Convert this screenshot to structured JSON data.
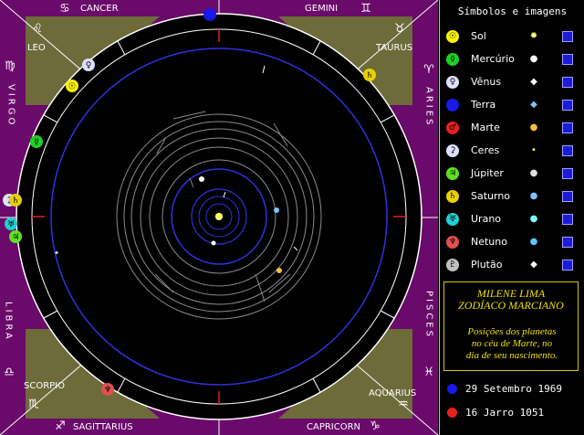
{
  "zodiac": {
    "cancer": "CANCER",
    "gemini": "GEMINI",
    "leo": "LEO",
    "taurus": "TAURUS",
    "virgo": "VIRGO",
    "aries": "ARIES",
    "libra": "LIBRA",
    "pisces": "PISCES",
    "scorpio": "SCORPIO",
    "aquarius": "AQUARIUS",
    "sagittarius": "SAGITTARIUS",
    "capricorn": "CAPRICORN"
  },
  "panel": {
    "title": "Símbolos e imagens",
    "planets": [
      {
        "name": "Sol",
        "color": "#f8f000",
        "glyph": "☉",
        "sym": "✹",
        "symColor": "#ffff80"
      },
      {
        "name": "Mercúrio",
        "color": "#20d020",
        "glyph": "☿",
        "sym": "●",
        "symColor": "#ffffff"
      },
      {
        "name": "Vênus",
        "color": "#e0e0ff",
        "glyph": "♀",
        "sym": "◆",
        "symColor": "#ffffff"
      },
      {
        "name": "Terra",
        "color": "#1818e8",
        "glyph": "",
        "sym": "◆",
        "symColor": "#80c0ff"
      },
      {
        "name": "Marte",
        "color": "#e82020",
        "glyph": "♂",
        "sym": "●",
        "symColor": "#f0c040"
      },
      {
        "name": "Ceres",
        "color": "#e0e0ff",
        "glyph": "⚳",
        "sym": "•",
        "symColor": "#ffff60"
      },
      {
        "name": "Júpiter",
        "color": "#60e020",
        "glyph": "♃",
        "sym": "●",
        "symColor": "#e0e0e0"
      },
      {
        "name": "Saturno",
        "color": "#e8d000",
        "glyph": "♄",
        "sym": "●",
        "symColor": "#80c0ff"
      },
      {
        "name": "Urano",
        "color": "#20d0d0",
        "glyph": "♅",
        "sym": "●",
        "symColor": "#80ffff"
      },
      {
        "name": "Netuno",
        "color": "#e05050",
        "glyph": "♆",
        "sym": "●",
        "symColor": "#60c0ff"
      },
      {
        "name": "Plutão",
        "color": "#c0c0c0",
        "glyph": "♇",
        "sym": "◆",
        "symColor": "#ffffff"
      }
    ]
  },
  "info": {
    "name_line1": "MILENE LIMA",
    "name_line2": "ZODÍACO MARCIANO",
    "desc_line1": "Posições dos planetas",
    "desc_line2": "no céu de Marte, no",
    "desc_line3": "dia de seu nascimento."
  },
  "dates": {
    "earth_date": "29 Setembro 1969",
    "mars_date": "16 Jarro 1051"
  }
}
